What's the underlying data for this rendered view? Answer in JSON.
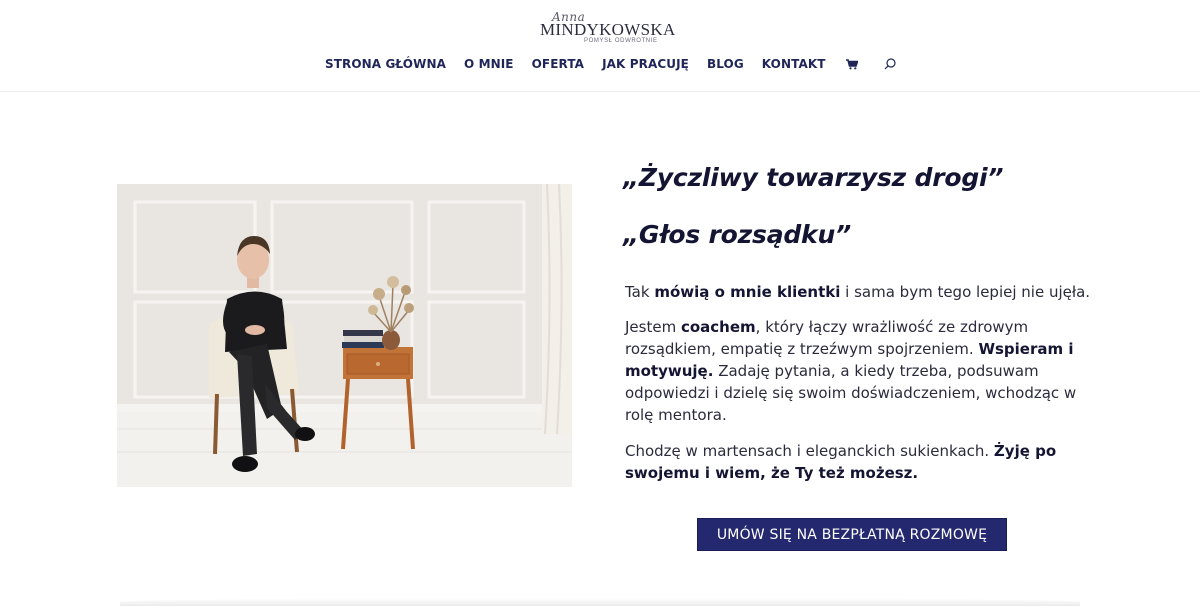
{
  "brand": {
    "script": "Anna",
    "name": "MINDYKOWSKA",
    "tagline": "POMYSŁ ODWROTNIE"
  },
  "nav": {
    "items": [
      "STRONA GŁÓWNA",
      "O MNIE",
      "OFERTA",
      "JAK PRACUJĘ",
      "BLOG",
      "KONTAKT"
    ],
    "icons": [
      "cart-icon",
      "search-icon"
    ]
  },
  "hero": {
    "heading1": "„Życzliwy towarzysz drogi”",
    "heading2": "„Głos rozsądku”",
    "p1": {
      "a": "Tak ",
      "b": "mówią o mnie klientki",
      "c": " i sama bym tego lepiej nie ujęła."
    },
    "p2": {
      "a": "Jestem ",
      "b": "coachem",
      "c": ", który łączy wrażliwość ze zdrowym rozsądkiem, empatię z trzeźwym spojrzeniem. ",
      "d": "Wspieram i motywuję.",
      "e": " Zadaję pytania, a kiedy trzeba, podsuwam odpowiedzi i dzielę się swoim doświadczeniem, wchodząc w rolę mentora."
    },
    "p3": {
      "a": "Chodzę w martensach i eleganckich sukienkach. ",
      "b": "Żyję po swojemu i wiem, że Ty też możesz."
    },
    "cta": "UMÓW SIĘ NA BEZPŁATNĄ ROZMOWĘ"
  },
  "colors": {
    "nav": "#1f2558",
    "heading": "#141433",
    "button": "#24286e"
  }
}
